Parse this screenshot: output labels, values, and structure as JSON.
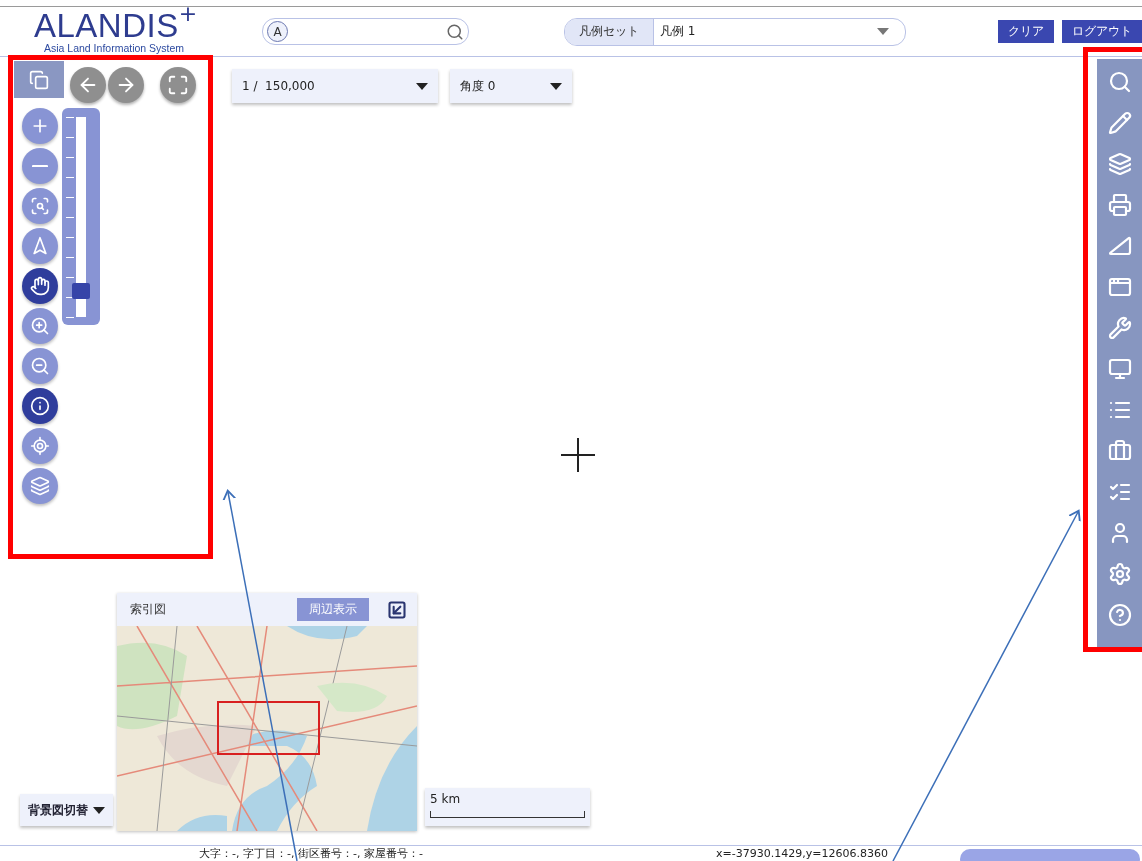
{
  "header": {
    "logo": "ALANDIS",
    "logo_mark": "+",
    "logo_subtitle": "Asia Land Information System",
    "search": {
      "badge": "A"
    },
    "legend_set": {
      "label": "凡例セット",
      "value": "凡例 1"
    },
    "buttons": [
      "クリア",
      "ログアウト"
    ]
  },
  "map_nav": [
    {
      "kind": "back"
    },
    {
      "kind": "forward"
    },
    {
      "kind": "fullscreen"
    }
  ],
  "left_tools": [
    {
      "kind": "plus",
      "selected": false
    },
    {
      "kind": "minus",
      "selected": false
    },
    {
      "kind": "zoom-area",
      "selected": false
    },
    {
      "kind": "north",
      "selected": false
    },
    {
      "kind": "pan",
      "selected": true
    },
    {
      "kind": "zoom-in",
      "selected": false
    },
    {
      "kind": "zoom-out",
      "selected": false
    },
    {
      "kind": "info",
      "selected": true
    },
    {
      "kind": "locate",
      "selected": false
    },
    {
      "kind": "layer-settings",
      "selected": false
    }
  ],
  "zoom_slider": {
    "level": 0.1
  },
  "scale": {
    "value": "1 /  150,000"
  },
  "angle": {
    "label": "角度",
    "value": "0"
  },
  "right_tools": [
    {
      "kind": "search"
    },
    {
      "kind": "pencil"
    },
    {
      "kind": "layers"
    },
    {
      "kind": "printer"
    },
    {
      "kind": "ruler"
    },
    {
      "kind": "windows"
    },
    {
      "kind": "tools"
    },
    {
      "kind": "monitor"
    },
    {
      "kind": "list"
    },
    {
      "kind": "briefcase"
    },
    {
      "kind": "checklist"
    },
    {
      "kind": "user"
    },
    {
      "kind": "settings"
    },
    {
      "kind": "help"
    }
  ],
  "index_map": {
    "title": "索引図",
    "button": "周辺表示"
  },
  "background_switch": "背景図切替",
  "scale_bar": "5 km",
  "status": {
    "address": "大字：-, 字丁目：-, 街区番号：-, 家屋番号：-",
    "coordinates": "x=-37930.1429,y=12606.8360"
  }
}
